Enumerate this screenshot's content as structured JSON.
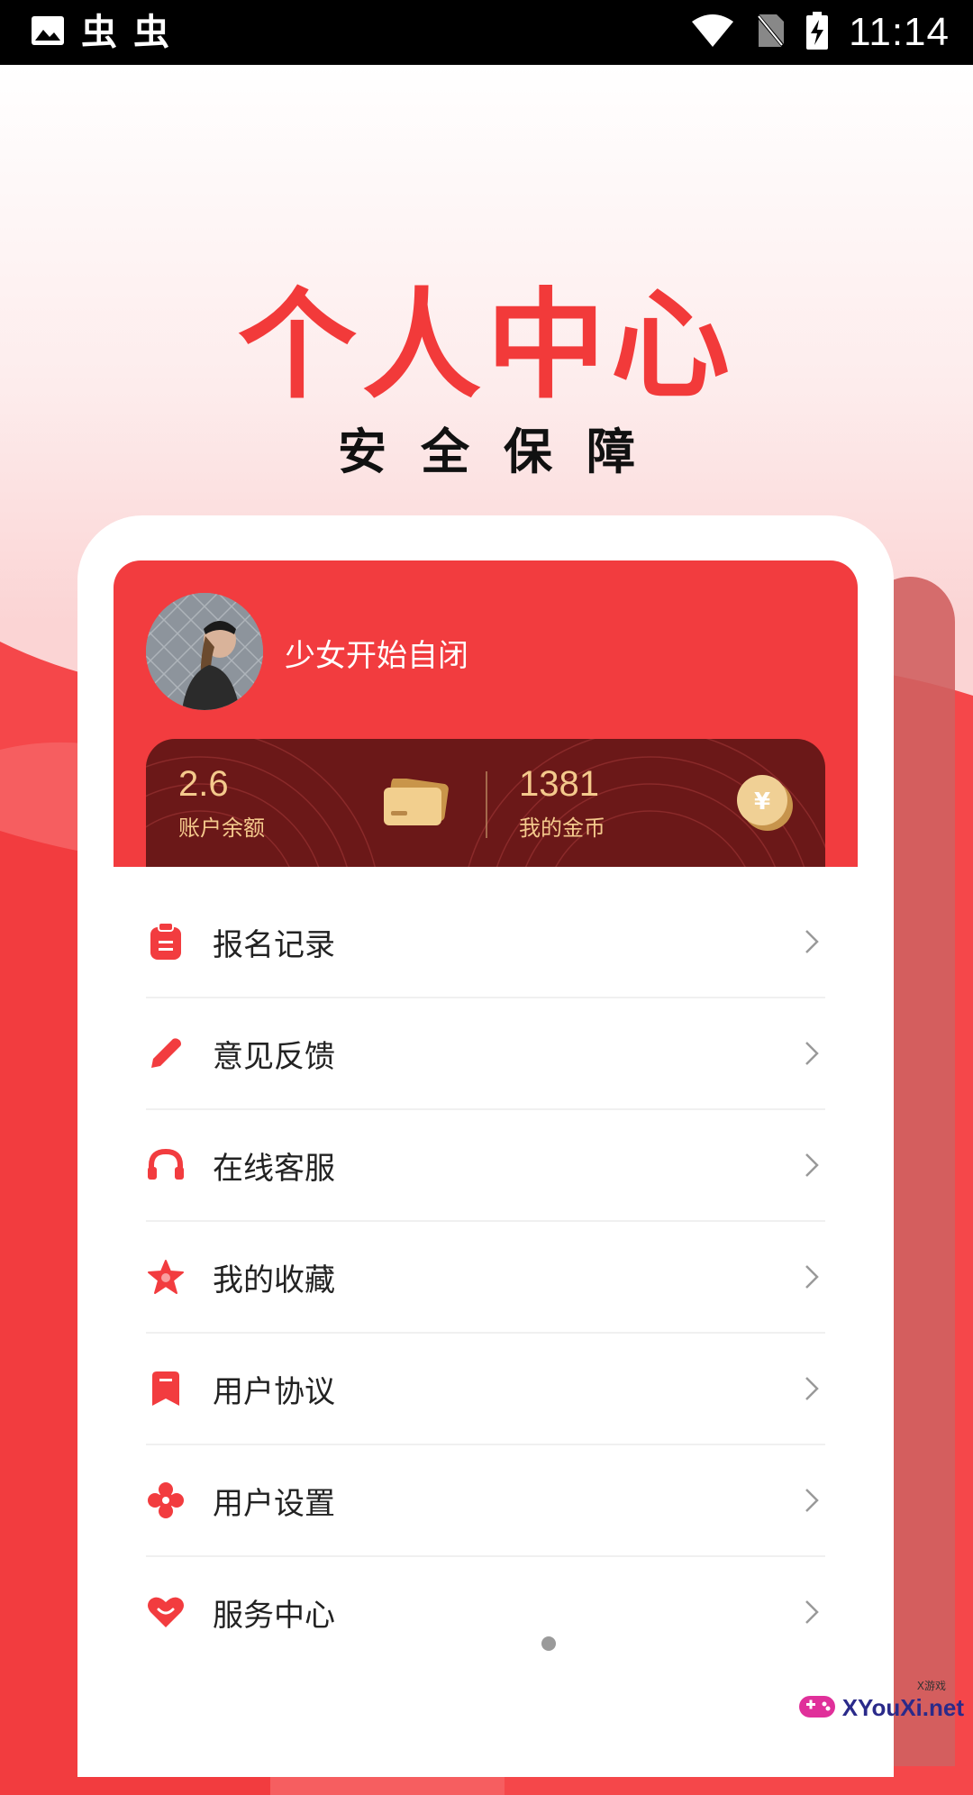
{
  "status_bar": {
    "app_icons": [
      "image-icon",
      "app-icon",
      "app-icon"
    ],
    "app_glyph": "虫",
    "time": "11:14"
  },
  "hero": {
    "title": "个人中心",
    "subtitle": "安全保障"
  },
  "profile": {
    "username": "少女开始自闭",
    "balance_value": "2.6",
    "balance_label": "账户余额",
    "coins_value": "1381",
    "coins_label": "我的金币",
    "coin_symbol": "¥"
  },
  "menu": {
    "items": [
      {
        "label": "报名记录",
        "icon": "clipboard-icon"
      },
      {
        "label": "意见反馈",
        "icon": "pencil-icon"
      },
      {
        "label": "在线客服",
        "icon": "headset-icon"
      },
      {
        "label": "我的收藏",
        "icon": "star-icon"
      },
      {
        "label": "用户协议",
        "icon": "bookmark-icon"
      },
      {
        "label": "用户设置",
        "icon": "settings-icon"
      },
      {
        "label": "服务中心",
        "icon": "heart-icon"
      }
    ]
  },
  "watermark": {
    "text": "XYouXi.net",
    "small": "X游戏"
  },
  "colors": {
    "accent": "#f23c3f",
    "wallet_bg": "#6b1818",
    "gold": "#f4c98c"
  }
}
